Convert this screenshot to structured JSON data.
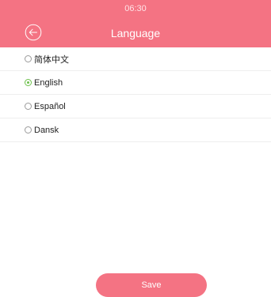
{
  "colors": {
    "accent": "#f47383",
    "radio_selected": "#6cc04a",
    "radio_unselected": "#9a9a9a"
  },
  "status_bar": {
    "time": "06:30"
  },
  "header": {
    "title": "Language",
    "back_icon": "back-arrow-circle-icon"
  },
  "languages": [
    {
      "label": "简体中文",
      "selected": false
    },
    {
      "label": "English",
      "selected": true
    },
    {
      "label": "Español",
      "selected": false
    },
    {
      "label": "Dansk",
      "selected": false
    }
  ],
  "footer": {
    "save_label": "Save"
  }
}
